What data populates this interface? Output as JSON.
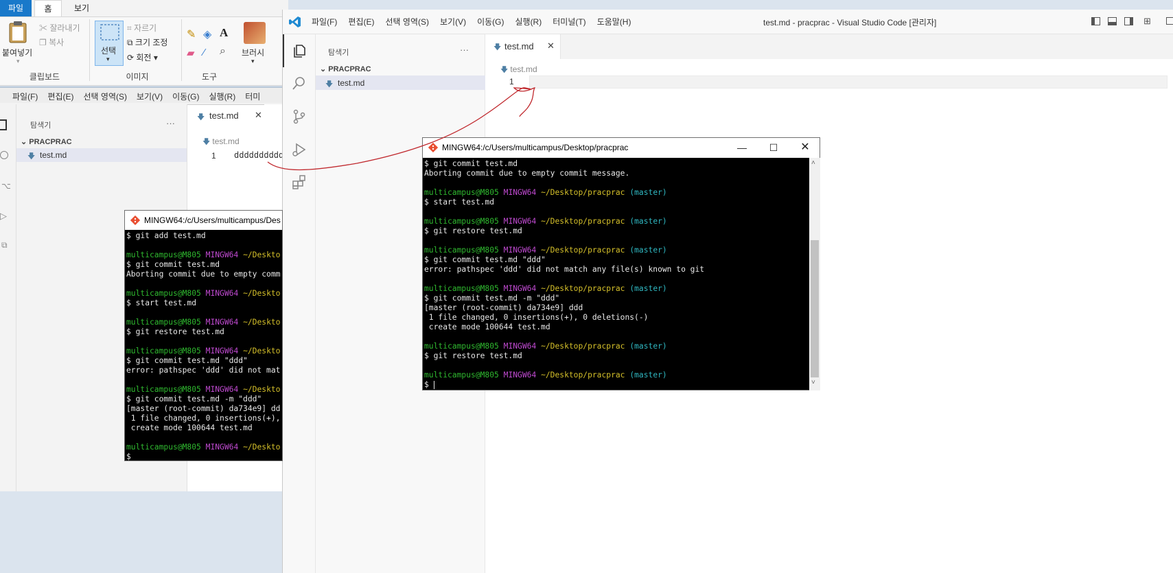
{
  "paint": {
    "tabs": [
      "파일",
      "홈",
      "보기"
    ],
    "clipboard": {
      "paste": "붙여넣기",
      "cut": "잘라내기",
      "copy": "복사",
      "group": "클립보드"
    },
    "image": {
      "select": "선택",
      "crop": "자르기",
      "resize": "크기 조정",
      "rotate": "회전",
      "group": "이미지"
    },
    "tools": {
      "group": "도구",
      "brush": "브러시"
    }
  },
  "vs_back": {
    "menu": [
      "파일(F)",
      "편집(E)",
      "선택 영역(S)",
      "보기(V)",
      "이동(G)",
      "실행(R)",
      "터미"
    ],
    "explorer_title": "탐색기",
    "dots": "···",
    "folder": "PRACPRAC",
    "file": "test.md",
    "tab": "test.md",
    "crumb": "test.md",
    "line_number": "1",
    "line_text": "dddddddddd"
  },
  "vs_front": {
    "menu": [
      "파일(F)",
      "편집(E)",
      "선택 영역(S)",
      "보기(V)",
      "이동(G)",
      "실행(R)",
      "터미널(T)",
      "도움말(H)"
    ],
    "title": "test.md - pracprac - Visual Studio Code [관리자]",
    "explorer_title": "탐색기",
    "dots": "···",
    "folder": "PRACPRAC",
    "file": "test.md",
    "tab": "test.md",
    "crumb": "test.md",
    "line_number": "1"
  },
  "term_back": {
    "title": "MINGW64:/c/Users/multicampus/Des"
  },
  "term_front": {
    "title": "MINGW64:/c/Users/multicampus/Desktop/pracprac"
  },
  "colors": {
    "prompt_user": "#2fb92f",
    "prompt_env": "#c04ad1",
    "prompt_path": "#d5c02a",
    "prompt_branch": "#2fb7c1",
    "annotation": "#c0282d",
    "accent": "#1979ca"
  }
}
